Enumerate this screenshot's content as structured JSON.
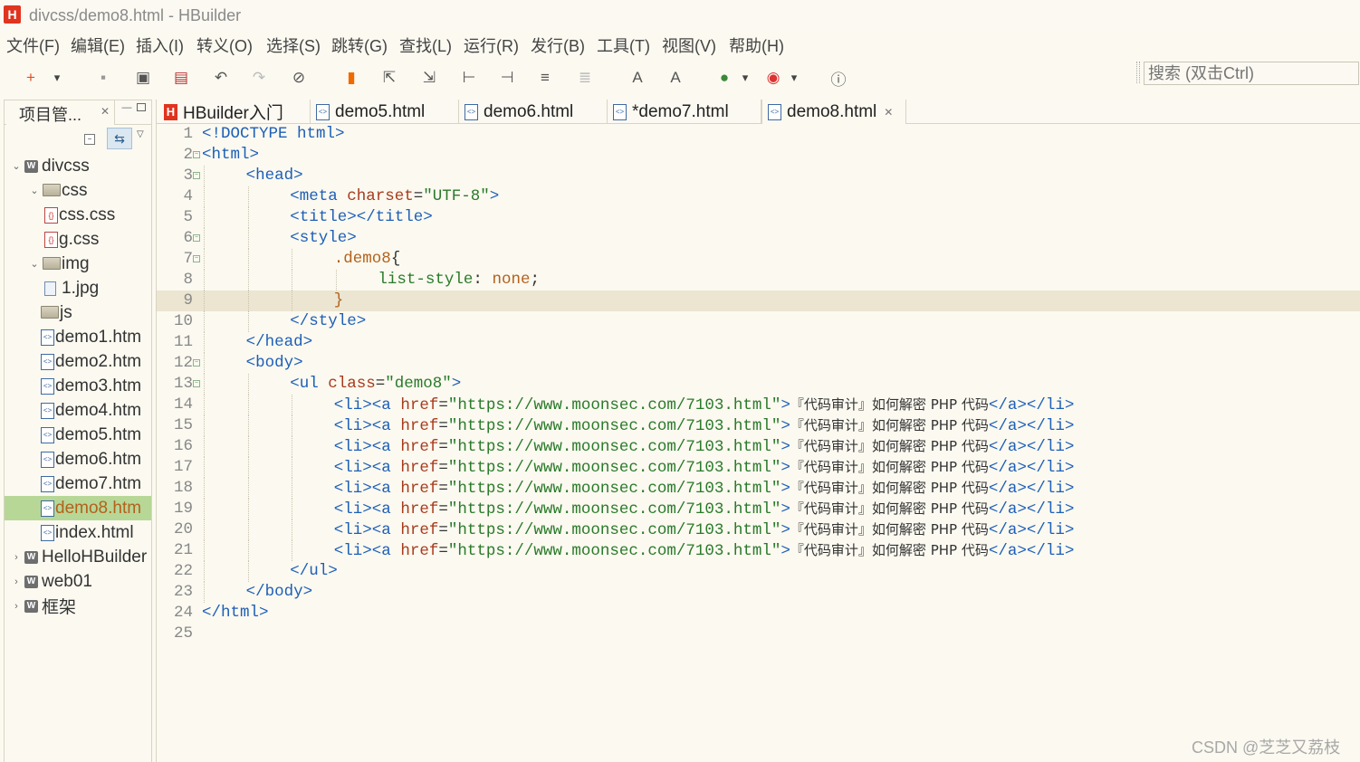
{
  "window": {
    "logo": "H",
    "title": "divcss/demo8.html  -  HBuilder"
  },
  "menu": [
    "文件(F)",
    "编辑(E)",
    "插入(I)",
    "转义(O)",
    "选择(S)",
    "跳转(G)",
    "查找(L)",
    "运行(R)",
    "发行(B)",
    "工具(T)",
    "视图(V)",
    "帮助(H)"
  ],
  "toolbar": {
    "icons": [
      "new-icon",
      "dropdown-icon",
      "save-icon",
      "save-all-icon",
      "close-file-icon",
      "undo-icon",
      "redo-icon",
      "format-icon",
      "bookmark-icon",
      "goto-top-icon",
      "goto-bottom-icon",
      "goto-line-start-icon",
      "goto-line-end-icon",
      "comment-icon",
      "uncomment-icon",
      "font-increase-icon",
      "font-decrease-icon",
      "run-icon",
      "run-dropdown-icon",
      "browser-icon",
      "browser-dropdown-icon",
      "console-icon"
    ],
    "search_placeholder": "搜索 (双击Ctrl)"
  },
  "project_panel": {
    "tab_label": "项目管...",
    "tree": [
      {
        "label": "divcss",
        "kind": "project",
        "expanded": true,
        "depth": 0
      },
      {
        "label": "css",
        "kind": "folder",
        "expanded": true,
        "depth": 1
      },
      {
        "label": "css.css",
        "kind": "css",
        "depth": 2
      },
      {
        "label": "g.css",
        "kind": "css",
        "depth": 2
      },
      {
        "label": "img",
        "kind": "folder",
        "expanded": true,
        "depth": 1
      },
      {
        "label": "1.jpg",
        "kind": "image",
        "depth": 2
      },
      {
        "label": "js",
        "kind": "folder",
        "depth": 1
      },
      {
        "label": "demo1.htm",
        "kind": "html",
        "depth": 1
      },
      {
        "label": "demo2.htm",
        "kind": "html",
        "depth": 1
      },
      {
        "label": "demo3.htm",
        "kind": "html",
        "depth": 1
      },
      {
        "label": "demo4.htm",
        "kind": "html",
        "depth": 1
      },
      {
        "label": "demo5.htm",
        "kind": "html",
        "depth": 1
      },
      {
        "label": "demo6.htm",
        "kind": "html",
        "depth": 1
      },
      {
        "label": "demo7.htm",
        "kind": "html",
        "depth": 1
      },
      {
        "label": "demo8.htm",
        "kind": "html",
        "depth": 1,
        "selected": true
      },
      {
        "label": "index.html",
        "kind": "html",
        "depth": 1
      },
      {
        "label": "HelloHBuilder",
        "kind": "project",
        "expanded": false,
        "depth": 0
      },
      {
        "label": "web01",
        "kind": "project",
        "expanded": false,
        "depth": 0
      },
      {
        "label": "框架",
        "kind": "project",
        "expanded": false,
        "depth": 0
      }
    ]
  },
  "editor": {
    "tabs": [
      {
        "label": "HBuilder入门",
        "icon": "hbuilder-icon"
      },
      {
        "label": "demo5.html",
        "icon": "html-file-icon"
      },
      {
        "label": "demo6.html",
        "icon": "html-file-icon"
      },
      {
        "label": "*demo7.html",
        "icon": "html-file-icon"
      },
      {
        "label": "demo8.html",
        "icon": "html-file-icon",
        "active": true
      }
    ],
    "current_line": 9,
    "lines": [
      {
        "n": "1",
        "indent": 0,
        "parts": [
          [
            "tg",
            "<!DOCTYPE html>"
          ]
        ]
      },
      {
        "n": "2",
        "indent": 0,
        "fold": true,
        "parts": [
          [
            "tg",
            "<html>"
          ]
        ]
      },
      {
        "n": "3",
        "indent": 1,
        "fold": true,
        "parts": [
          [
            "tg",
            "<head>"
          ]
        ]
      },
      {
        "n": "4",
        "indent": 2,
        "parts": [
          [
            "tg",
            "<meta "
          ],
          [
            "at",
            "charset"
          ],
          [
            "tx",
            "="
          ],
          [
            "vl",
            "\"UTF-8\""
          ],
          [
            "tg",
            ">"
          ]
        ]
      },
      {
        "n": "5",
        "indent": 2,
        "parts": [
          [
            "tg",
            "<title></title>"
          ]
        ]
      },
      {
        "n": "6",
        "indent": 2,
        "fold": true,
        "parts": [
          [
            "tg",
            "<style>"
          ]
        ]
      },
      {
        "n": "7",
        "indent": 3,
        "fold": true,
        "parts": [
          [
            "sel",
            ".demo8"
          ],
          [
            "tx",
            "{"
          ]
        ]
      },
      {
        "n": "8",
        "indent": 4,
        "parts": [
          [
            "vl",
            "list-style"
          ],
          [
            "tx",
            ": "
          ],
          [
            "sel",
            "none"
          ],
          [
            "tx",
            ";"
          ]
        ]
      },
      {
        "n": "9",
        "indent": 3,
        "parts": [
          [
            "sel",
            "}"
          ]
        ]
      },
      {
        "n": "10",
        "indent": 2,
        "parts": [
          [
            "tg",
            "</style>"
          ]
        ]
      },
      {
        "n": "11",
        "indent": 1,
        "parts": [
          [
            "tg",
            "</head>"
          ]
        ]
      },
      {
        "n": "12",
        "indent": 1,
        "fold": true,
        "parts": [
          [
            "tg",
            "<body>"
          ]
        ]
      },
      {
        "n": "13",
        "indent": 2,
        "fold": true,
        "parts": [
          [
            "tg",
            "<ul "
          ],
          [
            "at",
            "class"
          ],
          [
            "tx",
            "="
          ],
          [
            "vl",
            "\"demo8\""
          ],
          [
            "tg",
            ">"
          ]
        ]
      },
      {
        "n": "14",
        "indent": 3,
        "li": true
      },
      {
        "n": "15",
        "indent": 3,
        "li": true
      },
      {
        "n": "16",
        "indent": 3,
        "li": true
      },
      {
        "n": "17",
        "indent": 3,
        "li": true
      },
      {
        "n": "18",
        "indent": 3,
        "li": true
      },
      {
        "n": "19",
        "indent": 3,
        "li": true
      },
      {
        "n": "20",
        "indent": 3,
        "li": true
      },
      {
        "n": "21",
        "indent": 3,
        "li": true
      },
      {
        "n": "22",
        "indent": 2,
        "parts": [
          [
            "tg",
            "</ul>"
          ]
        ]
      },
      {
        "n": "23",
        "indent": 1,
        "parts": [
          [
            "tg",
            "</body>"
          ]
        ]
      },
      {
        "n": "24",
        "indent": 0,
        "parts": [
          [
            "tg",
            "</html>"
          ]
        ]
      },
      {
        "n": "25",
        "indent": 0,
        "parts": []
      }
    ],
    "li_line": {
      "open": "<li><a ",
      "attr": "href",
      "eq": "=",
      "url": "\"https://www.moonsec.com/7103.html\"",
      "gt": ">",
      "text": "『代码审计』如何解密 PHP 代码",
      "close": "</a></li>"
    }
  },
  "watermark": "CSDN @芝芝又荔枝",
  "colors": {
    "tag": "#1e5fb7",
    "attribute": "#a73b1d",
    "value": "#2a7a2a",
    "selector": "#b3611b",
    "current_line": "#ebe5d1",
    "selected_tree_item": "#b7d797"
  }
}
